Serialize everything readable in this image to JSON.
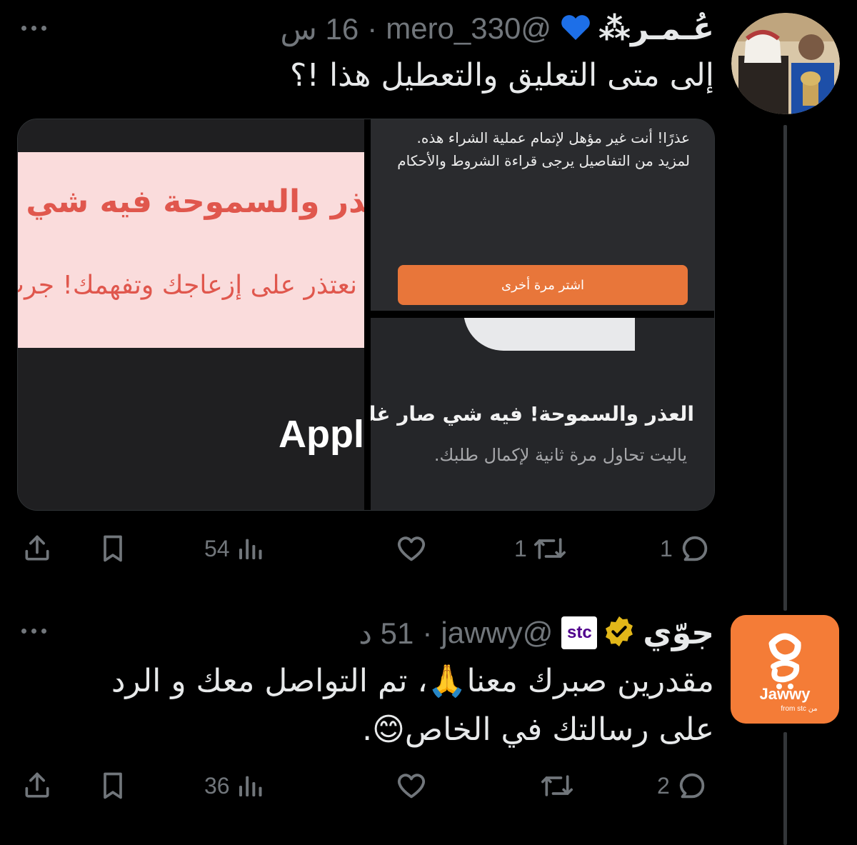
{
  "tweets": [
    {
      "display_name": "عُـمـر⁂",
      "emoji": "💙",
      "handle": "@mero_330",
      "separator": "·",
      "time": "16 س",
      "text": "إلى متى التعليق والتعطيل هذا !؟",
      "media": {
        "left_line1": "العذر والسموحة فيه شي صار غلط",
        "left_line2": "نعتذر على إزعاجك وتفهمك! جرب مرة ثانية",
        "left_brand": "Appl",
        "error_text": "عذرًا! أنت غير مؤهل لإتمام عملية الشراء هذه. لمزيد من التفاصيل يرجى قراءة الشروط والأحكام",
        "retry_label": "اشتر مرة أخرى",
        "oops_title": "العذر والسموحة! فيه شي صار غلط",
        "oops_sub": "ياليت تحاول مرة ثانية لإكمال طلبك."
      },
      "actions": {
        "replies": "1",
        "retweets": "1",
        "likes": "",
        "views": "54"
      }
    },
    {
      "display_name": "جوّي",
      "badge": "stc",
      "handle": "@jawwy",
      "separator": "·",
      "time": "51 د",
      "text_line1": "مقدرين صبرك معنا🙏، تم التواصل معك و الرد",
      "text_line2": "على رسالتك في الخاص😊.",
      "avatar": {
        "logo_text": "Jawwy",
        "sub_text": "from stc من",
        "color": "#f47c37"
      },
      "actions": {
        "replies": "2",
        "retweets": "",
        "likes": "",
        "views": "36"
      }
    }
  ],
  "colors": {
    "background": "#000000",
    "text": "#e7e9ea",
    "muted": "#71767b",
    "verified": "#e2b719",
    "accent_orange": "#e8763a"
  },
  "icons": [
    "reply-icon",
    "retweet-icon",
    "like-icon",
    "views-icon",
    "bookmark-icon",
    "share-icon",
    "more-icon",
    "verified-icon",
    "heart-emoji-icon"
  ]
}
